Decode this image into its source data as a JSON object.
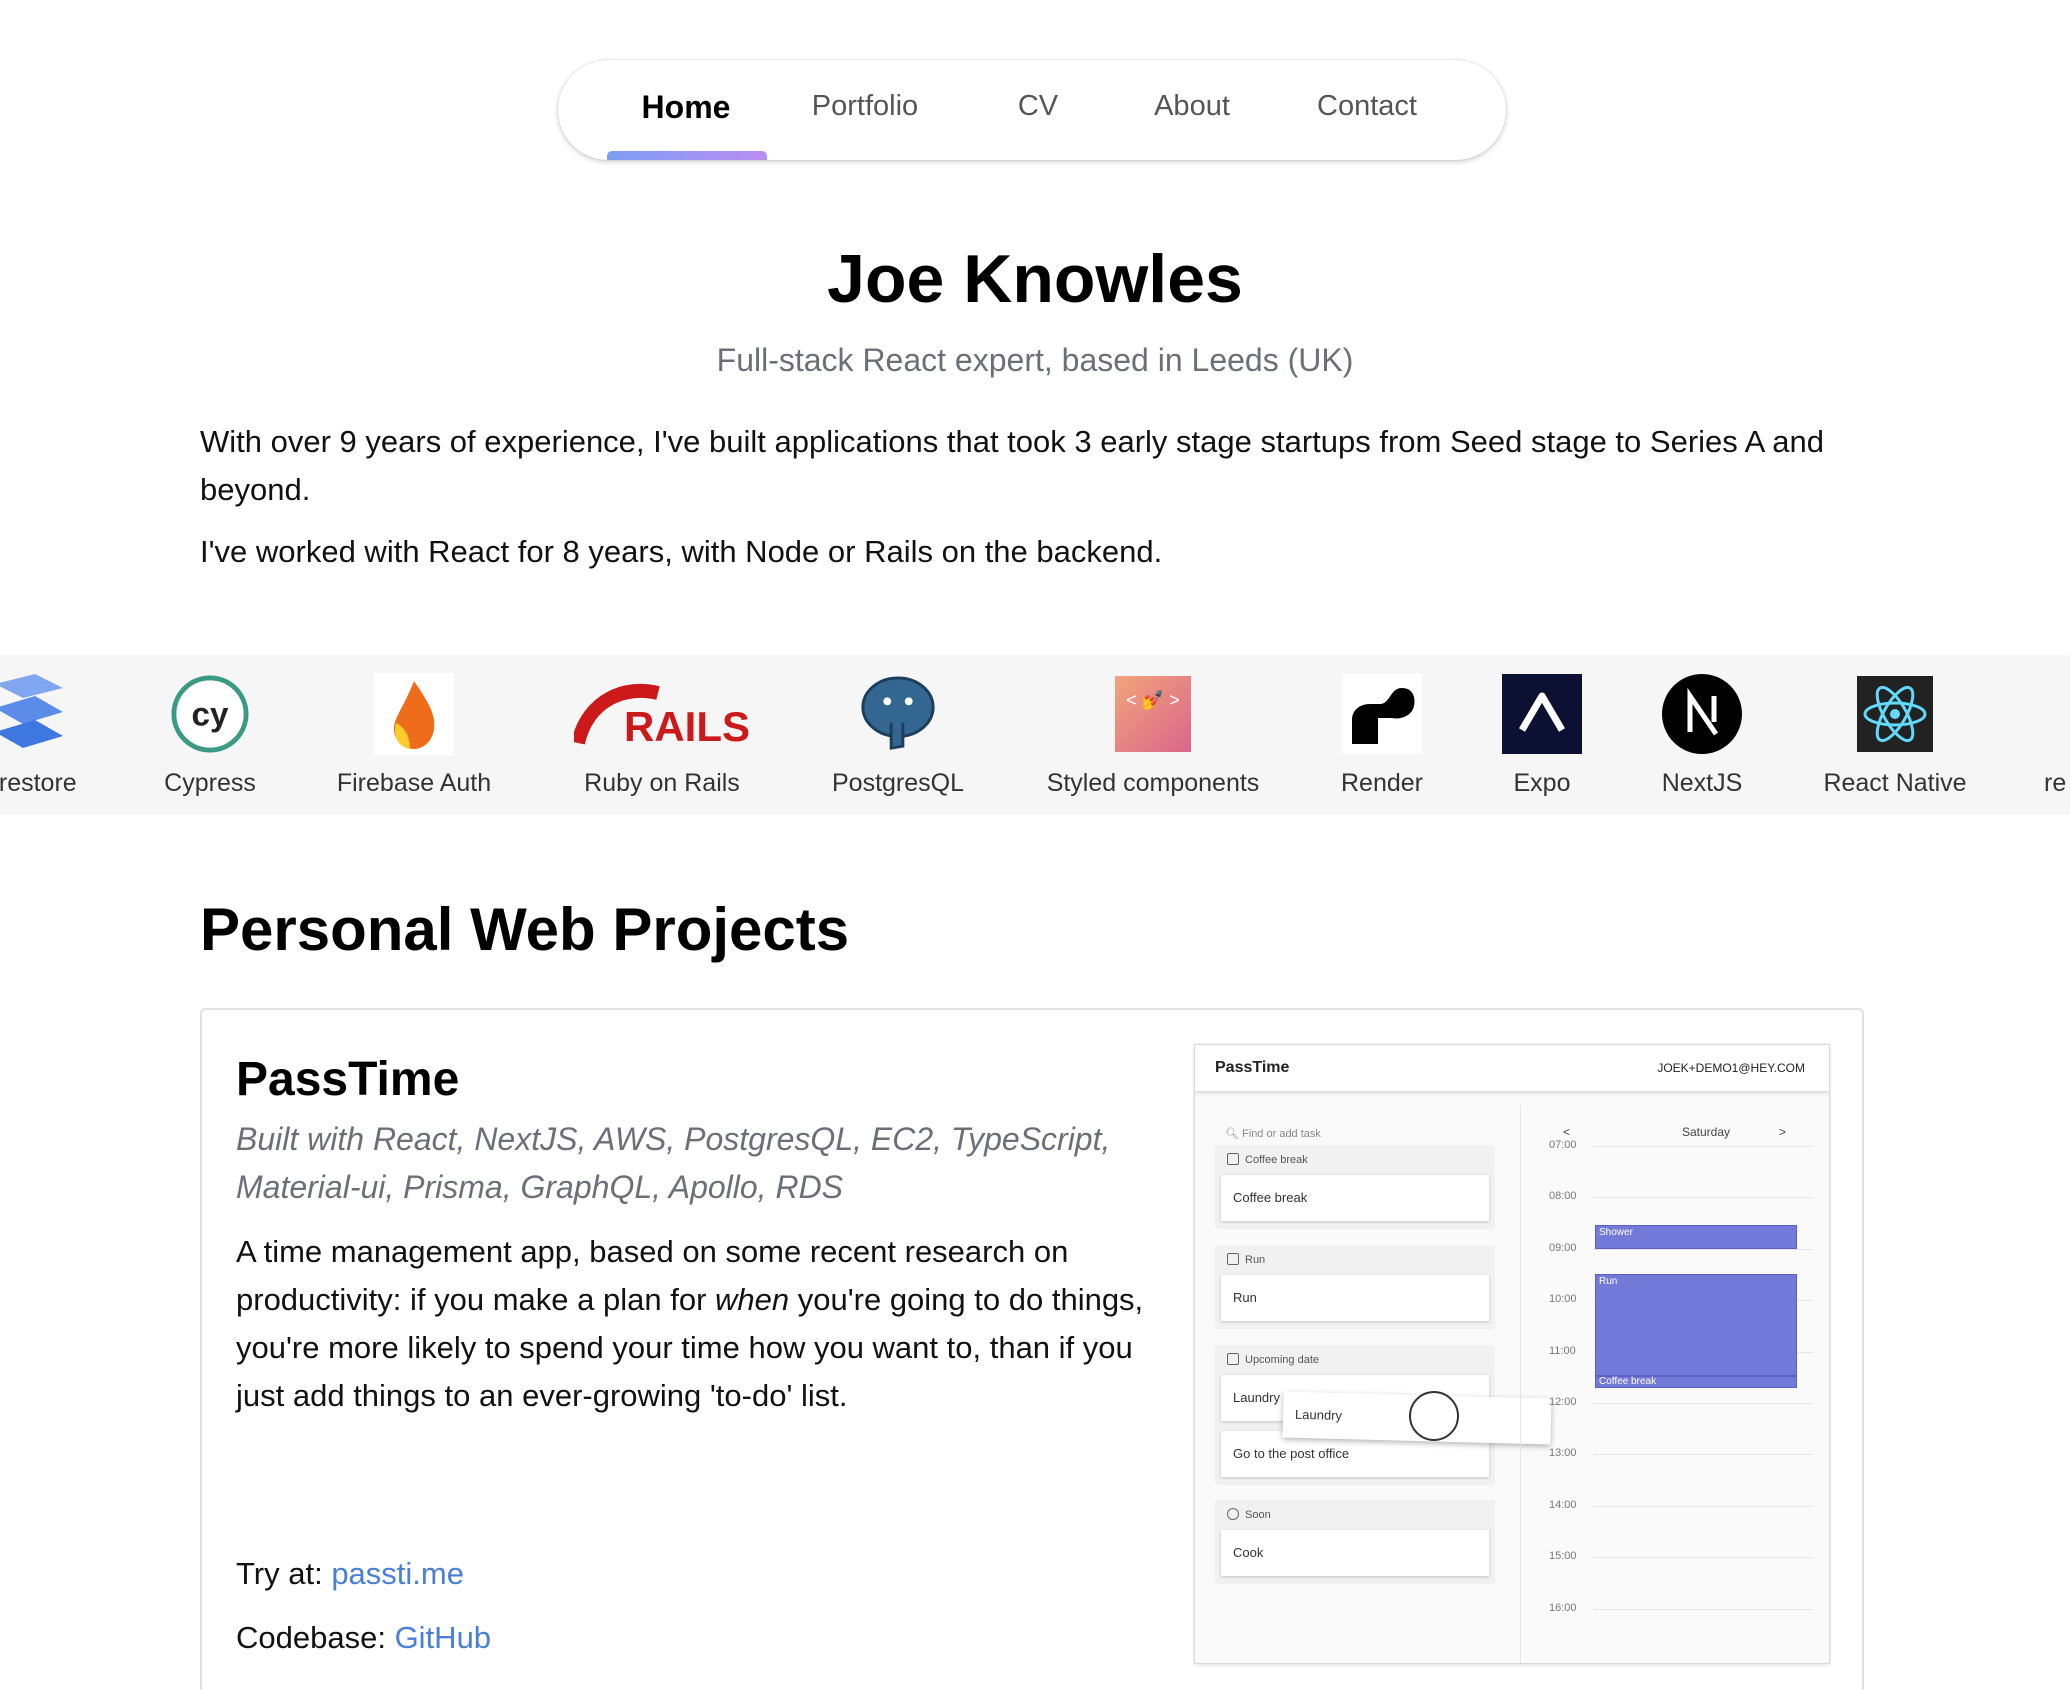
{
  "nav": {
    "items": [
      "Home",
      "Portfolio",
      "CV",
      "About",
      "Contact"
    ],
    "active": "Home"
  },
  "header": {
    "name": "Joe Knowles",
    "subtitle": "Full-stack React expert, based in Leeds (UK)",
    "intro_1": "With over 9 years of experience, I've built applications that took 3 early stage startups from Seed stage to Series A and beyond.",
    "intro_2": "I've worked with React for 8 years, with Node or Rails on the backend."
  },
  "tech_strip": {
    "items": [
      {
        "label": "irestore",
        "icon": "firestore-icon"
      },
      {
        "label": "Cypress",
        "icon": "cypress-icon"
      },
      {
        "label": "Firebase Auth",
        "icon": "firebase-icon"
      },
      {
        "label": "Ruby on Rails",
        "icon": "rails-icon"
      },
      {
        "label": "PostgresQL",
        "icon": "postgresql-icon"
      },
      {
        "label": "Styled components",
        "icon": "styled-components-icon"
      },
      {
        "label": "Render",
        "icon": "render-icon"
      },
      {
        "label": "Expo",
        "icon": "expo-icon"
      },
      {
        "label": "NextJS",
        "icon": "nextjs-icon"
      },
      {
        "label": "React Native",
        "icon": "react-icon"
      },
      {
        "label": "re",
        "icon": ""
      }
    ]
  },
  "projects": {
    "section_title": "Personal Web Projects",
    "items": [
      {
        "title": "PassTime",
        "built_with": "Built with React, NextJS, AWS, PostgresQL, EC2, TypeScript, Material-ui, Prisma, GraphQL, Apollo, RDS",
        "desc_a": "A time management app, based on some recent research on productivity: if you make a plan for ",
        "desc_em": "when",
        "desc_b": " you're going to do things, you're more likely to spend your time how you want to, than if you just add things to an ever-growing 'to-do' list.",
        "try_label": "Try at: ",
        "try_link": "passti.me",
        "code_label": "Codebase: ",
        "code_link": "GitHub"
      }
    ]
  },
  "mock": {
    "app_name": "PassTime",
    "user": "JOEK+DEMO1@HEY.COM",
    "search_placeholder": "Find or add task",
    "groups": [
      {
        "head": "Coffee break",
        "tasks": [
          "Coffee break"
        ]
      },
      {
        "head": "Run",
        "tasks": [
          "Run"
        ]
      },
      {
        "head": "Upcoming date",
        "tasks": [
          "Laundry",
          "Go to the post office"
        ]
      },
      {
        "head": "Soon",
        "tasks": [
          "Cook"
        ]
      }
    ],
    "dragging_task": "Laundry",
    "day": "Saturday",
    "prev": "<",
    "next": ">",
    "hours": [
      "07:00",
      "08:00",
      "09:00",
      "10:00",
      "11:00",
      "12:00",
      "13:00",
      "14:00",
      "15:00",
      "16:00"
    ],
    "events": [
      "Shower",
      "Run",
      "Coffee break"
    ],
    "event_color": "#7379d8"
  }
}
